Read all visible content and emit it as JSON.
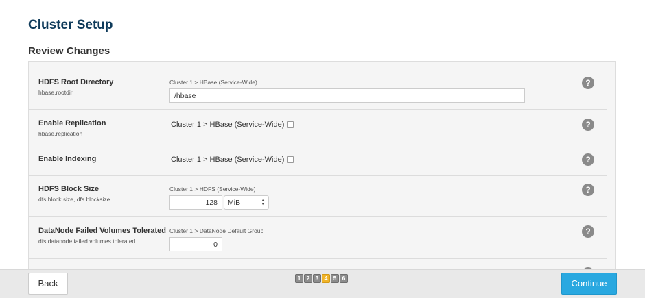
{
  "page": {
    "title": "Cluster Setup",
    "section_title": "Review Changes"
  },
  "rows": [
    {
      "title": "HDFS Root Directory",
      "property": "hbase.rootdir",
      "scope": "Cluster 1 > HBase (Service-Wide)",
      "value": "/hbase"
    },
    {
      "title": "Enable Replication",
      "property": "hbase.replication",
      "scope": "Cluster 1 > HBase (Service-Wide)",
      "checked": false
    },
    {
      "title": "Enable Indexing",
      "scope": "Cluster 1 > HBase (Service-Wide)",
      "checked": false
    },
    {
      "title": "HDFS Block Size",
      "property": "dfs.block.size, dfs.blocksize",
      "scope": "Cluster 1 > HDFS (Service-Wide)",
      "value": "128",
      "unit": "MiB"
    },
    {
      "title": "DataNode Failed Volumes Tolerated",
      "property": "dfs.datanode.failed.volumes.tolerated",
      "scope": "Cluster 1 > DataNode Default Group",
      "value": "0"
    }
  ],
  "help_icon": "?",
  "footer": {
    "back_label": "Back",
    "continue_label": "Continue",
    "steps": [
      "1",
      "2",
      "3",
      "4",
      "5",
      "6"
    ],
    "current_step": 4
  },
  "colors": {
    "title": "#0e3a5a",
    "continue_button": "#29a8e0",
    "active_step": "#f0b429",
    "step": "#8d8d8d",
    "help_icon": "#8a8a8a"
  },
  "icons": {
    "help": "help-icon",
    "select_caret": "updown-caret-icon"
  }
}
